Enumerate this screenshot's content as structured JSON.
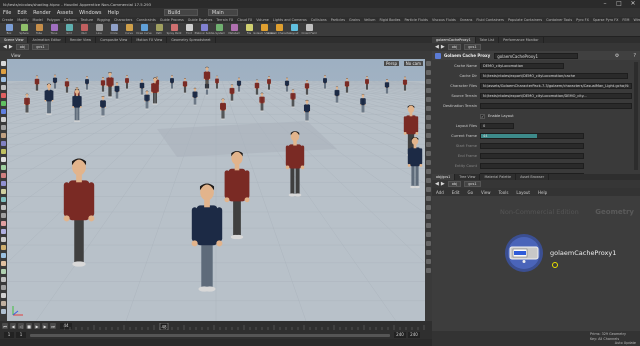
{
  "titlebar": {
    "title": "N:/tests/nicolas/shading.hipnc - Houdini Apprentice Non-Commercial 17.5.293",
    "minimize": "–",
    "maximize": "□",
    "close": "✕"
  },
  "menubar": {
    "items": [
      "File",
      "Edit",
      "Render",
      "Assets",
      "Windows",
      "Help"
    ],
    "build": "Build",
    "main": "Main"
  },
  "shelf_tabs": [
    "Create",
    "Modify",
    "Model",
    "Polygon",
    "Deform",
    "Texture",
    "Rigging",
    "Characters",
    "Constraints",
    "Guide Process",
    "Guide Brushes",
    "Terrain FX",
    "Cloud FX",
    "Volume",
    "Lights and Cameras",
    "Collisions",
    "Particles",
    "Grains",
    "Vellum",
    "Rigid Bodies",
    "Particle Fluids",
    "Viscous Fluids",
    "Oceans",
    "Fluid Containers",
    "Populate Containers",
    "Container Tools",
    "Pyro FX",
    "Sparse Pyro FX",
    "FEM",
    "Wires",
    "Crowds",
    "Drive Sim"
  ],
  "shelf_tools": [
    "Box",
    "Sphere",
    "Tube",
    "Torus",
    "Grid",
    "Null",
    "Line",
    "Circle",
    "Curve",
    "Draw Curve",
    "Path",
    "Spray Paint",
    "Font",
    "Platonic Solids",
    "L-System",
    "Metaball",
    "File",
    "Golaem Shaders",
    "Golaem Character",
    "Layout",
    "Crowd Field"
  ],
  "left_pane": {
    "tabs": [
      "Scene View",
      "Animation Editor",
      "Render View",
      "Composite View",
      "Motion FX View",
      "Geometry Spreadsheet"
    ],
    "path": [
      "obj",
      "gcs1"
    ],
    "viewport_label": "View",
    "viewport_right_labels": [
      "Persp",
      "No cam"
    ]
  },
  "timeline": {
    "current_frame": "44",
    "start_frame": "1",
    "end_frame": "240",
    "range_start": "1",
    "range_end": "240",
    "tick_labels": [
      "48"
    ]
  },
  "right_top": {
    "tabs": [
      "golaemCacheProxy1",
      "Take List",
      "Performance Monitor"
    ],
    "path": [
      "obj",
      "gcs1"
    ],
    "node_type": "Golaem Cache Proxy",
    "node_name": "golaemCacheProxy1",
    "params": [
      {
        "label": "Cache Name",
        "value": "DEMO_cityLocomotion"
      },
      {
        "label": "Cache Dir",
        "value": "N:/tests/ntoles/export/DEMO_cityLocomotion/cache"
      },
      {
        "label": "Character Files",
        "value": "N:/assets/GolaemCharacterPack-7.3/golaem/characters/CasualMan_Light.gcha;N:"
      },
      {
        "label": "Source Terrain",
        "value": "N:/tests/ntoles/export/DEMO_cityLocomotion/DEMO_city..."
      },
      {
        "label": "Destination Terrain",
        "value": ""
      },
      {
        "label": "Enable Layout",
        "value": ""
      },
      {
        "label": "Layout Files",
        "value": "0"
      },
      {
        "label": "Current Frame",
        "value": "44"
      },
      {
        "label": "Start Frame",
        "value": ""
      },
      {
        "label": "End Frame",
        "value": ""
      },
      {
        "label": "Entity Count",
        "value": ""
      },
      {
        "label": "Draw Entity Percent",
        "value": "100"
      },
      {
        "label": "Display Mode",
        "value": ""
      }
    ]
  },
  "network": {
    "tabs": [
      "obj/gcs1",
      "Tree View",
      "Material Palette",
      "Asset Browser"
    ],
    "path": [
      "obj",
      "gcs1"
    ],
    "menu": [
      "Add",
      "Edit",
      "Go",
      "View",
      "Tools",
      "Layout",
      "Help"
    ],
    "watermark": "Non-Commercial Edition",
    "context_label": "Geometry",
    "node_label": "golaemCacheProxy1",
    "bottom_left": "Prims: 329 Geometry",
    "bottom_right": "Key: All Channels",
    "footer_right": "Auto Update"
  },
  "colors": {
    "shirt_red": "#7a2a24",
    "shirt_navy": "#1c2a45",
    "ground": "#b8c1c9",
    "node_ring": "#3a5fd8",
    "current_frame_bar": "#3d8a8a"
  }
}
